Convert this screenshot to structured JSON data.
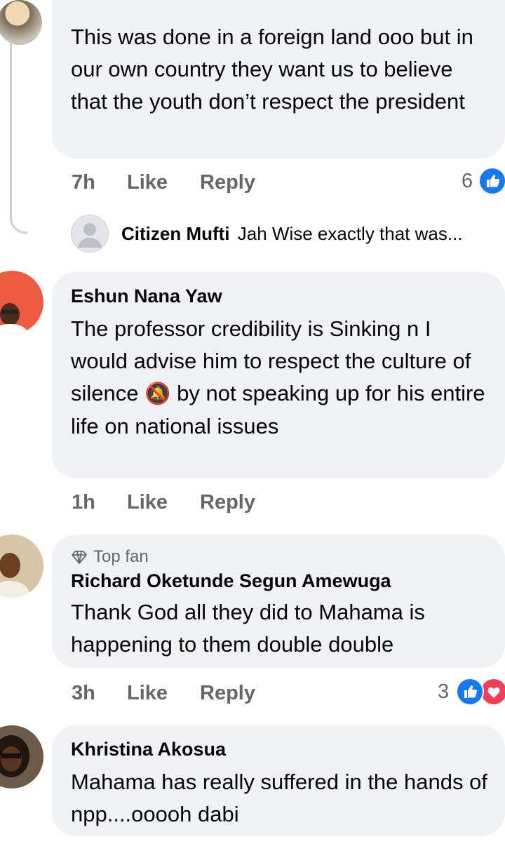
{
  "comments": [
    {
      "text": "This was done in a foreign land ooo but in our own country they want us to believe that the youth don’t respect the president",
      "time": "7h",
      "like": "Like",
      "reply": "Reply",
      "reaction_count": "6"
    },
    {
      "author": "Eshun Nana Yaw",
      "text_before_emoji": "The professor  credibility is Sinking n I would advise him to respect the culture of silence",
      "emoji": "🔕",
      "text_after_emoji": " by not speaking up for his entire life on national issues",
      "time": "1h",
      "like": "Like",
      "reply": "Reply"
    },
    {
      "badge": "Top fan",
      "author": "Richard Oketunde Segun Amewuga",
      "text": "Thank God all they did to Mahama is happening to them double double",
      "time": "3h",
      "like": "Like",
      "reply": "Reply",
      "reaction_count": "3"
    },
    {
      "author": "Khristina Akosua",
      "text": "Mahama has really suffered in the hands of npp....ooooh dabi"
    }
  ],
  "reply_preview": {
    "author": "Citizen Mufti",
    "text": "Jah Wise exactly that was..."
  },
  "colors": {
    "bubble": "#f0f2f5",
    "meta": "#65676b",
    "like_blue": "#1877f2",
    "love_red": "#f33e58"
  },
  "icons": [
    "thumbs-up-reaction-icon",
    "love-reaction-icon",
    "diamond-icon",
    "muted-bell-icon"
  ]
}
